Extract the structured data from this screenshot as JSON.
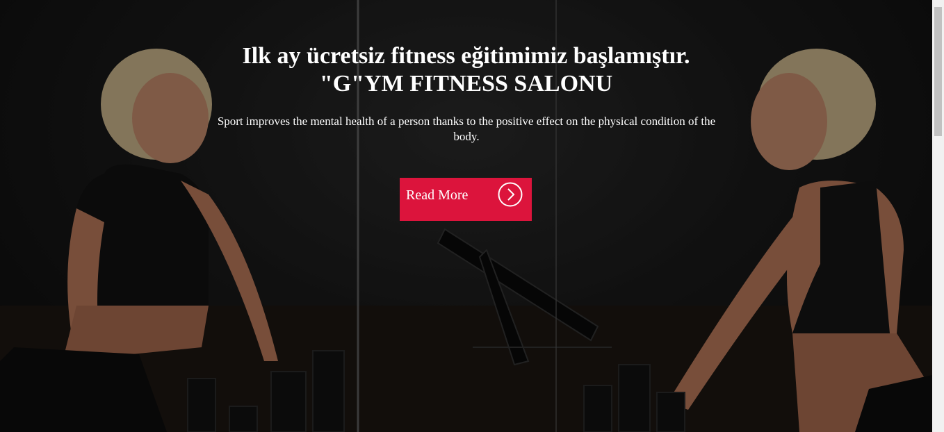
{
  "hero": {
    "headline_line1": "Ilk ay ücretsiz fitness eğitimimiz başlamıştır.",
    "headline_line2": "\"G\"YM FITNESS SALONU",
    "description": "Sport improves the mental health of a person thanks to the positive effect on the physical condition of the body.",
    "read_more_label": "Read More",
    "read_more_icon": "chevron-right-circle-icon",
    "accent_color": "#dc143c",
    "background_image": "woman-lifting-dumbbells-mirror-photo"
  }
}
